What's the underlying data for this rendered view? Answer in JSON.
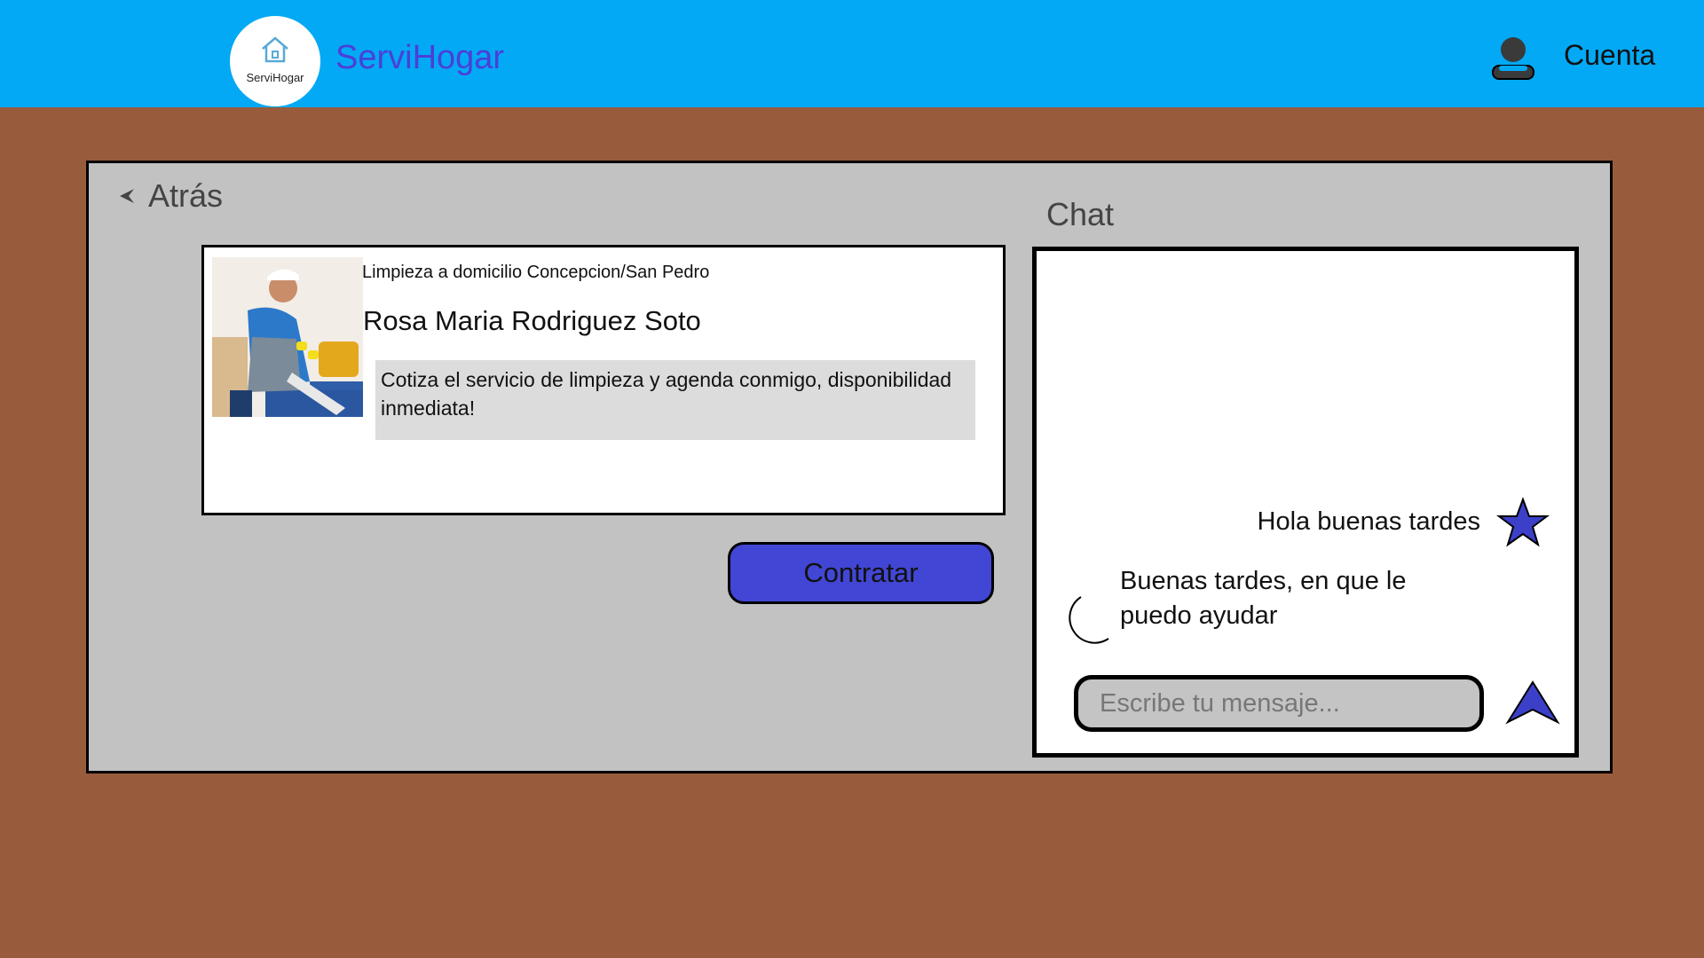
{
  "header": {
    "logo_text": "ServiHogar",
    "brand": "ServiHogar",
    "account_label": "Cuenta"
  },
  "nav": {
    "back_label": "Atrás"
  },
  "service": {
    "title": "Limpieza a domicilio Concepcion/San Pedro",
    "provider_name": "Rosa Maria Rodriguez Soto",
    "description": "Cotiza el servicio de limpieza y agenda conmigo, disponibilidad inmediata!",
    "hire_label": "Contratar"
  },
  "chat": {
    "title": "Chat",
    "messages": [
      {
        "side": "right",
        "text": "Hola buenas tardes",
        "icon": "star-icon"
      },
      {
        "side": "left",
        "text": "Buenas tardes, en que le puedo ayudar",
        "icon": "moon-icon"
      }
    ],
    "input_placeholder": "Escribe tu mensaje..."
  },
  "colors": {
    "header_bg": "#03a9f4",
    "page_bg": "#985c3c",
    "panel_bg": "#c2c2c2",
    "accent": "#4246d4",
    "brand_text": "#4b3fd8"
  }
}
